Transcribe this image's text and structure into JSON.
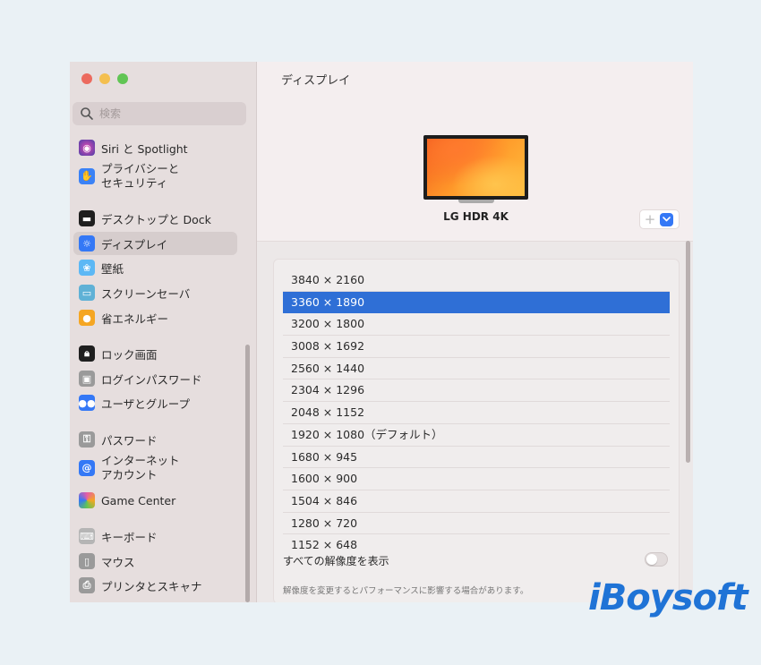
{
  "window": {
    "title": "ディスプレイ"
  },
  "sidebar": {
    "search": {
      "placeholder": "検索"
    },
    "items": [
      {
        "label": "Siri と Spotlight",
        "icon": "siri-icon",
        "color": "#4b3fa8"
      },
      {
        "label": "プライバシーと\nセキュリティ",
        "icon": "hand-icon",
        "color": "#3b82f6"
      },
      {
        "label": "デスクトップと Dock",
        "icon": "dock-icon",
        "color": "#1f1f1f"
      },
      {
        "label": "ディスプレイ",
        "icon": "display-icon",
        "color": "#3478f6",
        "selected": true
      },
      {
        "label": "壁紙",
        "icon": "wallpaper-icon",
        "color": "#5cb8f5"
      },
      {
        "label": "スクリーンセーバ",
        "icon": "screensaver-icon",
        "color": "#5fb1d6"
      },
      {
        "label": "省エネルギー",
        "icon": "energy-icon",
        "color": "#f5a623"
      },
      {
        "label": "ロック画面",
        "icon": "lock-icon",
        "color": "#1f1f1f"
      },
      {
        "label": "ログインパスワード",
        "icon": "login-lock-icon",
        "color": "#9a9a9a"
      },
      {
        "label": "ユーザとグループ",
        "icon": "users-icon",
        "color": "#3478f6"
      },
      {
        "label": "パスワード",
        "icon": "key-icon",
        "color": "#9a9a9a"
      },
      {
        "label": "インターネット\nアカウント",
        "icon": "at-icon",
        "color": "#3478f6"
      },
      {
        "label": "Game Center",
        "icon": "game-center-icon",
        "color": "#e65ea8"
      },
      {
        "label": "キーボード",
        "icon": "keyboard-icon",
        "color": "#b5b5b5"
      },
      {
        "label": "マウス",
        "icon": "mouse-icon",
        "color": "#9a9a9a"
      },
      {
        "label": "プリンタとスキャナ",
        "icon": "printer-icon",
        "color": "#9a9a9a"
      }
    ]
  },
  "main": {
    "monitor_name": "LG HDR 4K",
    "add_symbol": "+",
    "resolutions": [
      "3840 × 2160",
      "3360 × 1890",
      "3200 × 1800",
      "3008 × 1692",
      "2560 × 1440",
      "2304 × 1296",
      "2048 × 1152",
      "1920 × 1080（デフォルト）",
      "1680 × 945",
      "1600 × 900",
      "1504 × 846",
      "1280 × 720",
      "1152 × 648"
    ],
    "selected_resolution_index": 1,
    "show_all_label": "すべての解像度を表示",
    "show_all_enabled": false,
    "note": "解像度を変更するとパフォーマンスに影響する場合があります。"
  },
  "watermark": {
    "text": "iBoysoft",
    "color": "#1f73d6"
  }
}
